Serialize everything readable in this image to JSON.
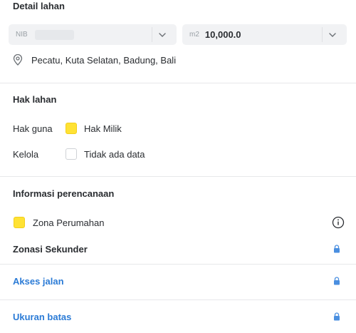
{
  "detail": {
    "title": "Detail lahan",
    "nib_prefix": "NIB",
    "area_prefix": "m2",
    "area_value": "10,000.0",
    "location": "Pecatu, Kuta Selatan, Badung, Bali"
  },
  "hak": {
    "title": "Hak lahan",
    "rows": [
      {
        "label": "Hak guna",
        "value": "Hak Milik",
        "color": "#ffe234"
      },
      {
        "label": "Kelola",
        "value": "Tidak ada data",
        "color": "#ffffff"
      }
    ]
  },
  "perencanaan": {
    "title": "Informasi perencanaan",
    "zona": {
      "value": "Zona Perumahan",
      "color": "#ffe234"
    },
    "zonasi_sekunder": "Zonasi Sekunder",
    "akses_jalan": "Akses jalan",
    "ukuran_batas": "Ukuran batas"
  },
  "colors": {
    "accent_link": "#2b7bd6",
    "lock": "#4a8fe0"
  },
  "icons": {
    "location": "location-pin-icon",
    "dropdown": "chevron-down-icon",
    "info": "info-icon",
    "lock": "lock-icon"
  }
}
